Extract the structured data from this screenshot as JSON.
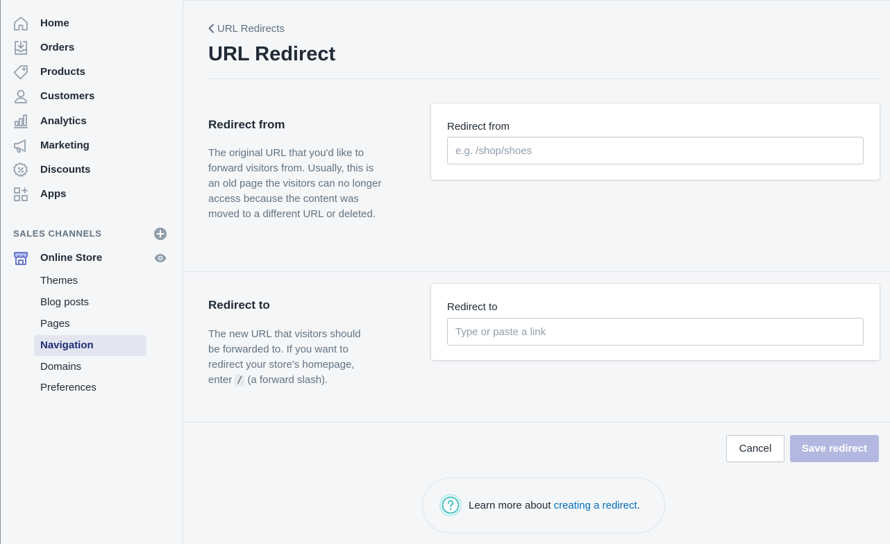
{
  "sidebar": {
    "items": [
      {
        "label": "Home",
        "icon": "home-icon"
      },
      {
        "label": "Orders",
        "icon": "orders-inbox-icon"
      },
      {
        "label": "Products",
        "icon": "tag-icon"
      },
      {
        "label": "Customers",
        "icon": "person-icon"
      },
      {
        "label": "Analytics",
        "icon": "bar-chart-icon"
      },
      {
        "label": "Marketing",
        "icon": "megaphone-icon"
      },
      {
        "label": "Discounts",
        "icon": "discount-badge-icon"
      },
      {
        "label": "Apps",
        "icon": "apps-grid-icon"
      }
    ],
    "sales_channels_title": "SALES CHANNELS",
    "online_store": "Online Store",
    "sub_items": [
      "Themes",
      "Blog posts",
      "Pages",
      "Navigation",
      "Domains",
      "Preferences"
    ],
    "active_sub_item": "Navigation"
  },
  "breadcrumb": "URL Redirects",
  "page_title": "URL Redirect",
  "redirect_from": {
    "heading": "Redirect from",
    "description": "The original URL that you'd like to forward visitors from. Usually, this is an old page the visitors can no longer access because the content was moved to a different URL or deleted.",
    "field_label": "Redirect from",
    "placeholder": "e.g. /shop/shoes",
    "value": ""
  },
  "redirect_to": {
    "heading": "Redirect to",
    "description_before": "The new URL that visitors should be forwarded to. If you want to redirect your store's homepage, enter ",
    "code": "/",
    "description_after": " (a forward slash).",
    "field_label": "Redirect to",
    "placeholder": "Type or paste a link",
    "value": ""
  },
  "buttons": {
    "cancel": "Cancel",
    "save": "Save redirect",
    "save_disabled": true
  },
  "help": {
    "text_before": "Learn more about ",
    "link": "creating a redirect",
    "text_after": "."
  },
  "colors": {
    "accent": "#5c6ac4",
    "primary_disabled": "#b3b8e0",
    "link": "#006fbb",
    "help_icon": "#47c1bf",
    "active_nav_bg": "#e3e5f1"
  }
}
